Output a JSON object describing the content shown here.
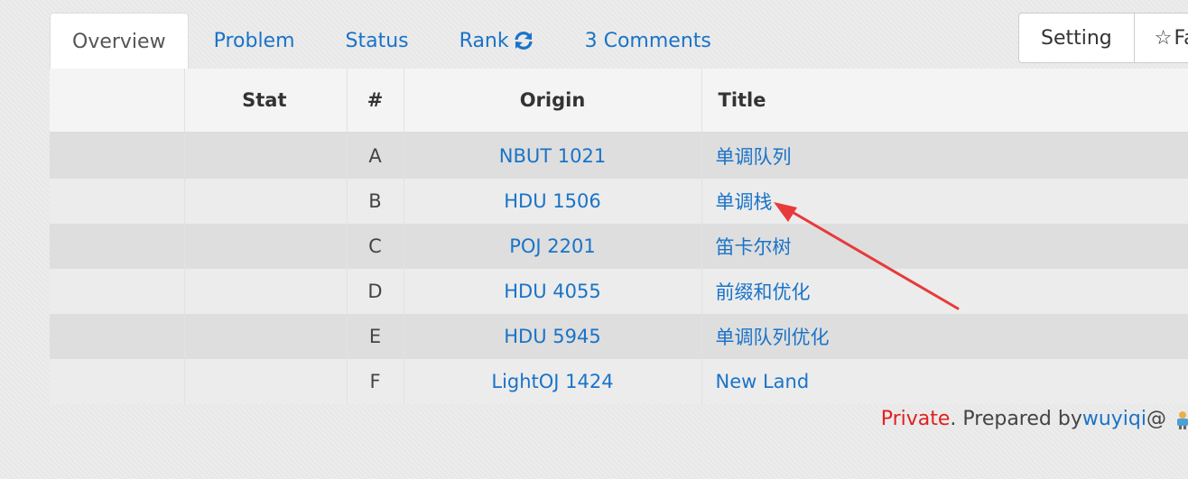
{
  "tabs": [
    {
      "label": "Overview",
      "active": true
    },
    {
      "label": "Problem"
    },
    {
      "label": "Status"
    },
    {
      "label": "Rank"
    },
    {
      "label": "3 Comments"
    }
  ],
  "buttons": {
    "setting": "Setting",
    "favorite_partial": "Fa"
  },
  "table": {
    "headers": [
      "",
      "Stat",
      "#",
      "Origin",
      "Title"
    ],
    "rows": [
      {
        "idx": "A",
        "origin": "NBUT 1021",
        "title": "单调队列"
      },
      {
        "idx": "B",
        "origin": "HDU 1506",
        "title": "单调栈"
      },
      {
        "idx": "C",
        "origin": "POJ 2201",
        "title": "笛卡尔树"
      },
      {
        "idx": "D",
        "origin": "HDU 4055",
        "title": "前缀和优化"
      },
      {
        "idx": "E",
        "origin": "HDU 5945",
        "title": "单调队列优化"
      },
      {
        "idx": "F",
        "origin": "LightOJ 1424",
        "title": "New Land"
      }
    ]
  },
  "footer": {
    "private": "Private",
    "prepared_by": ". Prepared by ",
    "user": "wuyiqi",
    "at": " @"
  },
  "colors": {
    "link": "#1a73c8",
    "private": "#e02020",
    "arrow": "#e83a3a"
  }
}
